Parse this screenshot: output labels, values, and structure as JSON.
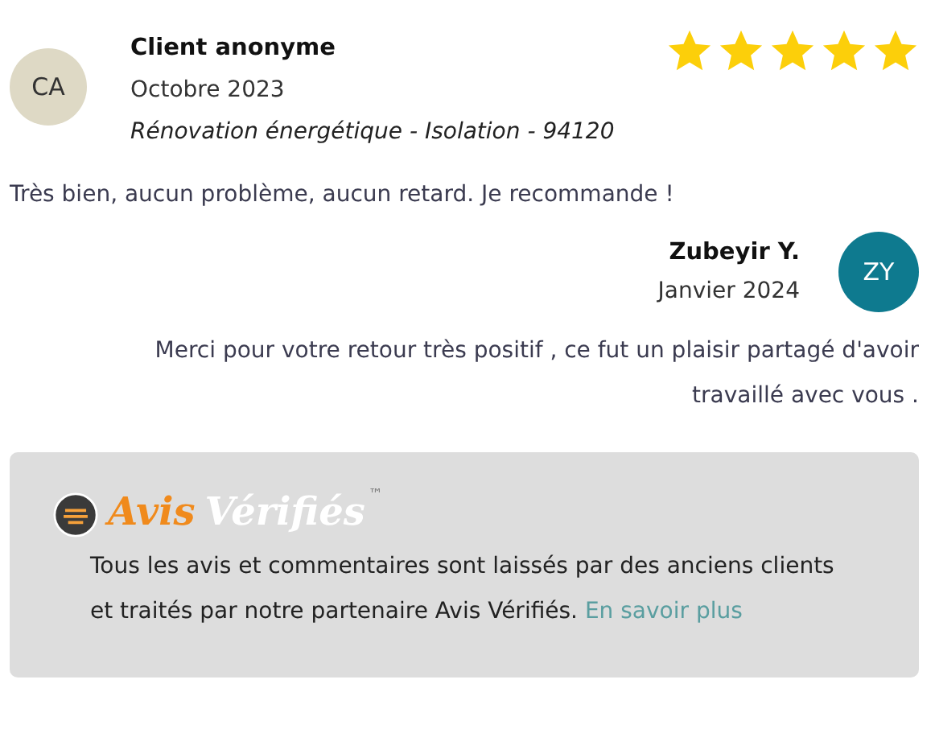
{
  "review": {
    "initials": "CA",
    "author": "Client anonyme",
    "date": "Octobre 2023",
    "project": "Rénovation énergétique - Isolation - 94120",
    "stars": 5,
    "text": "Très bien, aucun problème, aucun retard. Je recommande !"
  },
  "reply": {
    "initials": "ZY",
    "author": "Zubeyir Y.",
    "date": "Janvier 2024",
    "text": "Merci pour votre retour très positif , ce fut  un plaisir partagé d'avoir travaillé avec vous ."
  },
  "notice": {
    "logo": {
      "first": "Avis",
      "second": "Vérifiés",
      "mark": "™"
    },
    "text": "Tous les avis et commentaires sont laissés par des anciens clients et traités par notre partenaire Avis Vérifiés.",
    "link": "En savoir plus"
  }
}
